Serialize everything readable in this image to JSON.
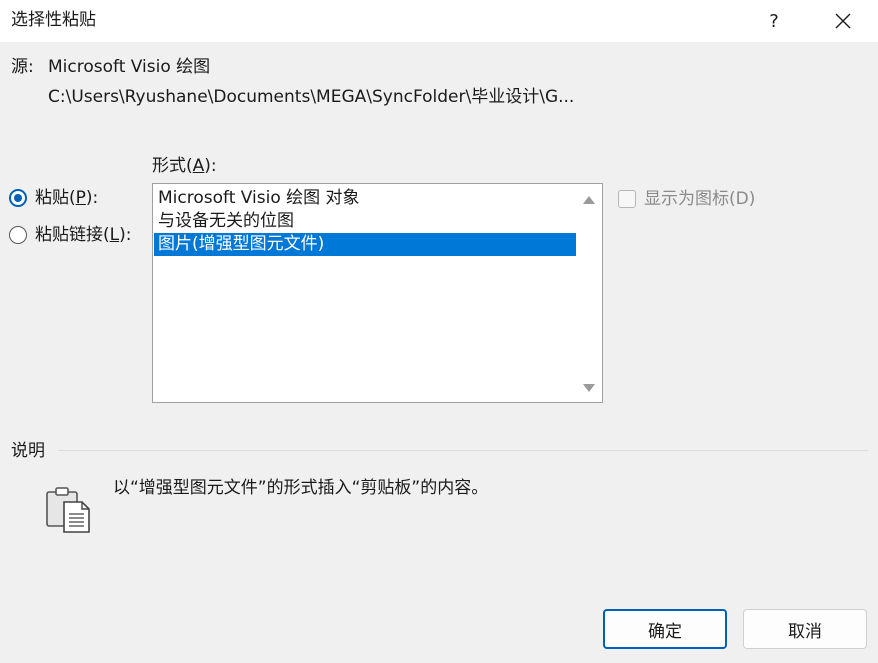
{
  "window": {
    "title": "选择性粘贴",
    "help_label": "?",
    "close_icon": "close-icon"
  },
  "source": {
    "label": "源:",
    "name": "Microsoft Visio 绘图",
    "path": "C:\\Users\\Ryushane\\Documents\\MEGA\\SyncFolder\\毕业设计\\G..."
  },
  "options": {
    "paste_label_pre": "粘贴(",
    "paste_label_key": "P",
    "paste_label_post": "):",
    "paste_selected": true,
    "paste_link_label_pre": "粘贴链接(",
    "paste_link_label_key": "L",
    "paste_link_label_post": "):",
    "paste_link_selected": false
  },
  "format": {
    "label_pre": "形式(",
    "label_key": "A",
    "label_post": "):",
    "items": [
      "Microsoft Visio 绘图 对象",
      "与设备无关的位图",
      "图片(增强型图元文件)"
    ],
    "selected_index": 2
  },
  "display_as_icon": {
    "label": "显示为图标(D)",
    "checked": false,
    "enabled": false
  },
  "description": {
    "label": "说明",
    "text": "以“增强型图元文件”的形式插入“剪贴板”的内容。",
    "icon": "clipboard-icon"
  },
  "buttons": {
    "ok": "确定",
    "cancel": "取消"
  },
  "colors": {
    "accent": "#005fb8",
    "selection": "#0078d7",
    "background": "#f0f0f0"
  }
}
